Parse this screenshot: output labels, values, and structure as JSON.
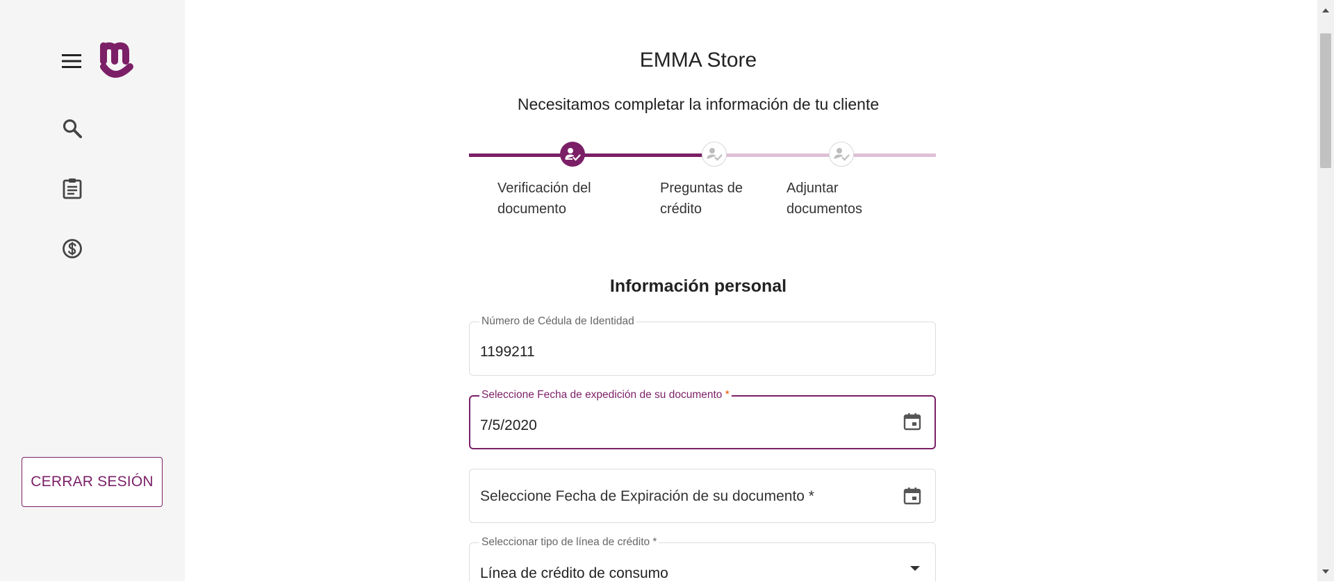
{
  "sidebar": {
    "icons": [
      "menu-icon",
      "logo-icon",
      "search-icon",
      "clipboard-icon",
      "dollar-icon"
    ],
    "logout_label": "CERRAR SESIÓN"
  },
  "header": {
    "store_name": "EMMA Store",
    "subtitle": "Necesitamos completar la información de tu cliente"
  },
  "stepper": {
    "steps": [
      {
        "line1": "Verificación del",
        "line2": "documento",
        "state": "active",
        "icon": "user-check-icon"
      },
      {
        "line1": "Preguntas de",
        "line2": "crédito",
        "state": "pending",
        "icon": "user-check-icon"
      },
      {
        "line1": "Adjuntar",
        "line2": "documentos",
        "state": "pending",
        "icon": "user-check-icon"
      }
    ]
  },
  "form": {
    "section_title": "Información personal",
    "cedula": {
      "label": "Número de Cédula de Identidad",
      "value": "1199211"
    },
    "issue_date": {
      "label": "Seleccione Fecha de expedición de su documento",
      "required": "*",
      "value": "7/5/2020",
      "icon": "calendar-icon"
    },
    "expiry_date": {
      "placeholder": "Seleccione Fecha de Expiración de su documento *",
      "icon": "calendar-icon"
    },
    "credit_line": {
      "label": "Seleccionar tipo de línea de crédito *",
      "value": "Línea de crédito de consumo",
      "icon": "dropdown-arrow-icon"
    }
  },
  "colors": {
    "brand": "#7b1f67",
    "brand_light": "#dfc0d6",
    "sidebar_bg": "#f5f5f5",
    "required": "#e65100"
  }
}
